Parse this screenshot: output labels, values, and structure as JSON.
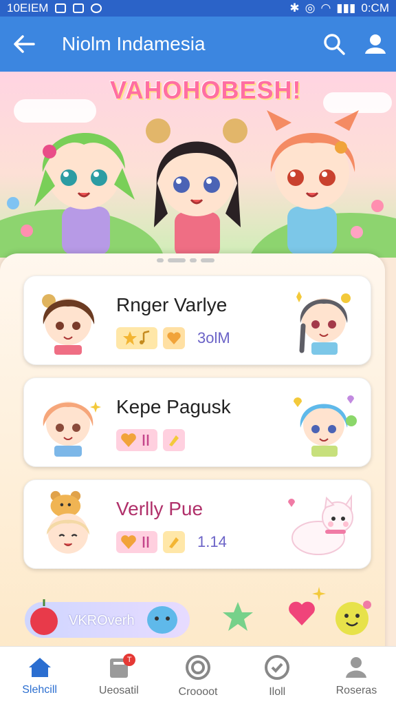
{
  "status_bar": {
    "left_text": "10EIEM",
    "right_text": "0:CM"
  },
  "app_bar": {
    "title": "Niolm Indamesia"
  },
  "banner": {
    "title": "VAHOHOBESH!"
  },
  "cards": [
    {
      "name": "Rnger Varlye",
      "count": "3olM"
    },
    {
      "name": "Kepe Pagusk",
      "count": ""
    },
    {
      "name": "Verlly Pue",
      "count": "1.14"
    }
  ],
  "bottom_strip": {
    "pill_label": "VKROverh"
  },
  "nav": {
    "items": [
      {
        "label": "Slehcill",
        "icon": "home-icon"
      },
      {
        "label": "Ueosatil",
        "icon": "notebook-icon",
        "badge": "T"
      },
      {
        "label": "Croooot",
        "icon": "record-icon"
      },
      {
        "label": "Iloll",
        "icon": "check-circle-icon"
      },
      {
        "label": "Roseras",
        "icon": "person-icon"
      }
    ]
  },
  "colors": {
    "primary": "#3c86e0",
    "accent_pink": "#ff6ea3",
    "active_nav": "#2b6ed0"
  }
}
